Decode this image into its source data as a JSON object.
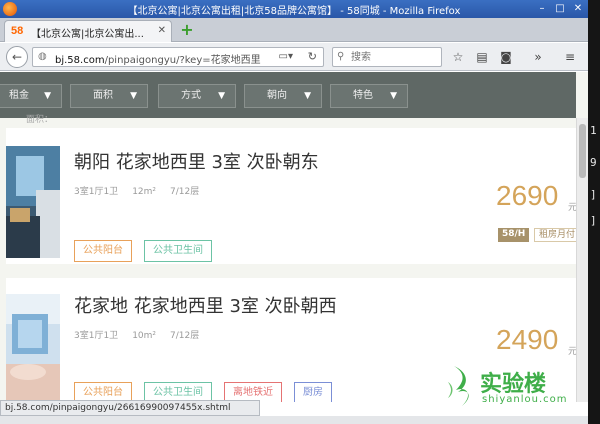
{
  "window": {
    "title": "【北京公寓|北京公寓出租|北京58品牌公寓馆】 - 58同城 - Mozilla Firefox",
    "minimize": "–",
    "maximize": "□",
    "close": "✕"
  },
  "tab": {
    "favicon": "58",
    "label": "【北京公寓|北京公寓出...",
    "close": "✕",
    "new_tab": "+"
  },
  "nav": {
    "url_domain": "bj.58.com",
    "url_path": "/pinpaigongyu/?key=花家地西里",
    "search_placeholder": "搜索"
  },
  "filters": [
    {
      "label": "租金"
    },
    {
      "label": "面积"
    },
    {
      "label": "方式"
    },
    {
      "label": "朝向"
    },
    {
      "label": "特色"
    }
  ],
  "partial_label": "面积：",
  "listings": [
    {
      "title": "朝阳 花家地西里 3室 次卧朝东",
      "layout": "3室1厅1卫",
      "area": "12m²",
      "floor": "7/12层",
      "price": "2690",
      "unit": "元",
      "badge_brand": "58/H",
      "badge_text": "租房月付",
      "tags": [
        {
          "label": "公共阳台",
          "color": "#e8a15a"
        },
        {
          "label": "公共卫生间",
          "color": "#6cc3a5"
        }
      ]
    },
    {
      "title": "花家地 花家地西里 3室 次卧朝西",
      "layout": "3室1厅1卫",
      "area": "10m²",
      "floor": "7/12层",
      "price": "2490",
      "unit": "元",
      "tags": [
        {
          "label": "公共阳台",
          "color": "#e8a15a"
        },
        {
          "label": "公共卫生间",
          "color": "#6cc3a5"
        },
        {
          "label": "离地铁近",
          "color": "#e57373"
        },
        {
          "label": "厨房",
          "color": "#7b8fd6"
        }
      ]
    }
  ],
  "status_url": "bj.58.com/pinpaigongyu/26616990097455x.shtml",
  "watermark": {
    "cn": "实验楼",
    "en": "shiyanlou.com"
  },
  "desktop_glyphs": [
    "1",
    "9",
    "]",
    "]"
  ]
}
